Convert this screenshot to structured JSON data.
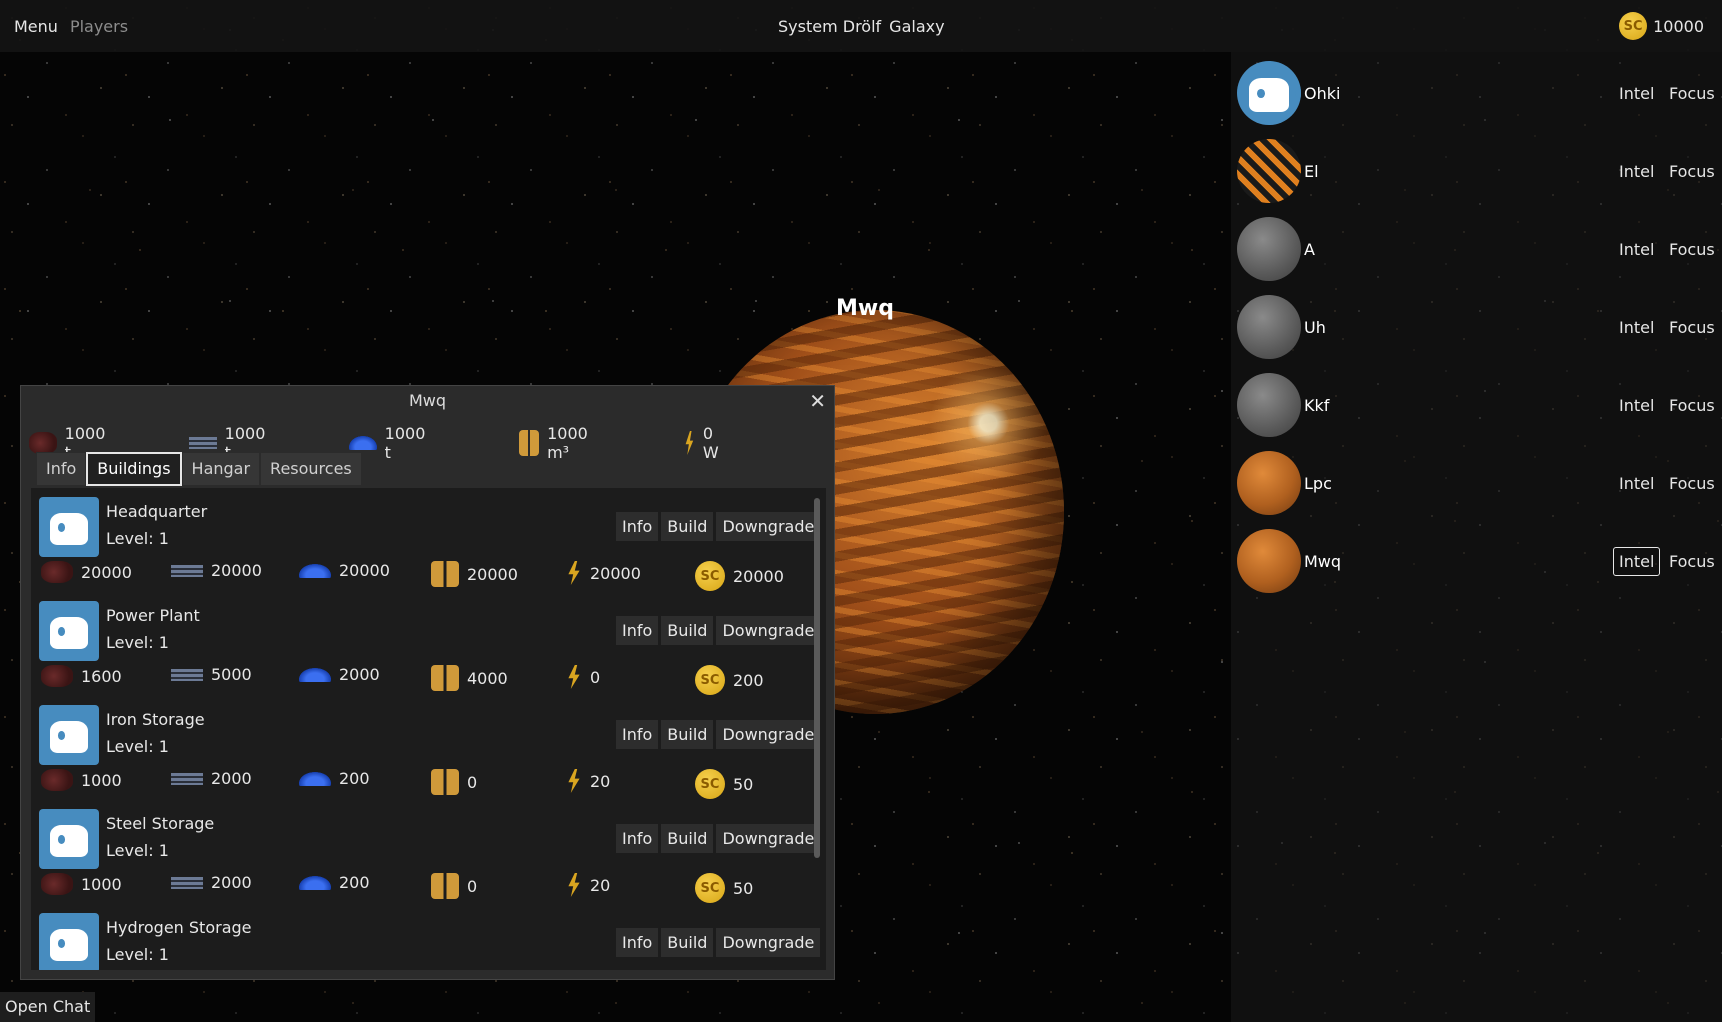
{
  "topbar": {
    "menu": "Menu",
    "players": "Players",
    "system": "System Drölf",
    "galaxy": "Galaxy",
    "coin_icon": "SC",
    "credits": "10000"
  },
  "planet": {
    "label": "Mwq"
  },
  "bodies": [
    {
      "name": "Ohki",
      "icon": "godot-icon",
      "intel": "Intel",
      "focus": "Focus"
    },
    {
      "name": "El",
      "icon": "el-moon-icon",
      "intel": "Intel",
      "focus": "Focus"
    },
    {
      "name": "A",
      "icon": "gray-moon-icon",
      "intel": "Intel",
      "focus": "Focus"
    },
    {
      "name": "Uh",
      "icon": "gray-moon-icon",
      "intel": "Intel",
      "focus": "Focus"
    },
    {
      "name": "Kkf",
      "icon": "gray-moon-icon",
      "intel": "Intel",
      "focus": "Focus"
    },
    {
      "name": "Lpc",
      "icon": "orange-planet-icon",
      "intel": "Intel",
      "focus": "Focus"
    },
    {
      "name": "Mwq",
      "icon": "orange-planet-icon",
      "intel": "Intel",
      "focus": "Focus"
    }
  ],
  "dialog": {
    "title": "Mwq",
    "resources": {
      "iron": "1000 t",
      "steel": "1000 t",
      "wave": "1000 t",
      "hydrogen": "1000 m³",
      "energy": "0 W"
    },
    "tabs": [
      "Info",
      "Buildings",
      "Hangar",
      "Resources"
    ],
    "active_tab": "Buildings",
    "buttons": {
      "info": "Info",
      "build": "Build",
      "downgrade": "Downgrade"
    },
    "buildings": [
      {
        "name": "Headquarter",
        "level": "Level: 1",
        "costs": [
          "20000",
          "20000",
          "20000",
          "20000",
          "20000",
          "20000"
        ]
      },
      {
        "name": "Power Plant",
        "level": "Level: 1",
        "costs": [
          "1600",
          "5000",
          "2000",
          "4000",
          "0",
          "200"
        ]
      },
      {
        "name": "Iron Storage",
        "level": "Level: 1",
        "costs": [
          "1000",
          "2000",
          "200",
          "0",
          "20",
          "50"
        ]
      },
      {
        "name": "Steel Storage",
        "level": "Level: 1",
        "costs": [
          "1000",
          "2000",
          "200",
          "0",
          "20",
          "50"
        ]
      },
      {
        "name": "Hydrogen Storage",
        "level": "Level: 1",
        "costs": []
      }
    ]
  },
  "chat": {
    "open": "Open Chat"
  }
}
